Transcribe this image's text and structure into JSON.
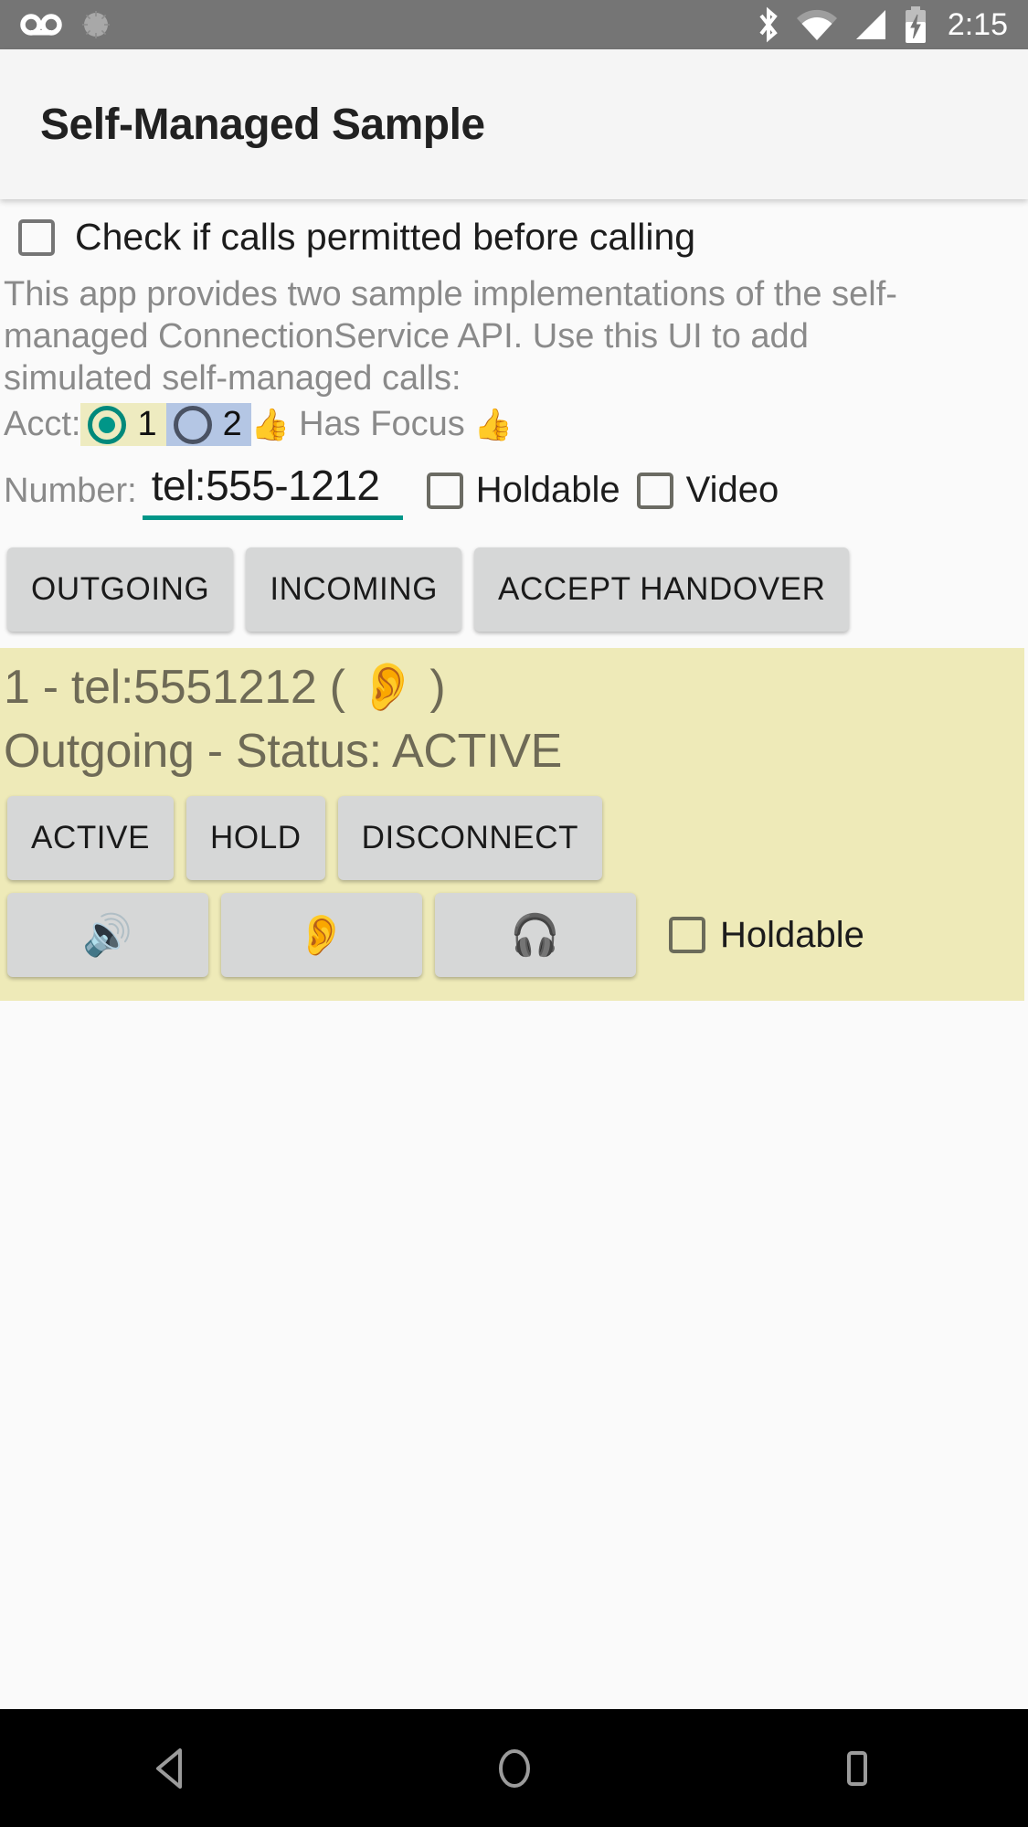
{
  "status_bar": {
    "background": "#757575",
    "time": "2:15",
    "left_icons": [
      {
        "name": "voicemail-icon",
        "glyph": "voicemail"
      },
      {
        "name": "sync-spinner-icon",
        "glyph": "spinner"
      }
    ],
    "right_icons": [
      {
        "name": "bluetooth-icon",
        "glyph": "bluetooth"
      },
      {
        "name": "wifi-icon",
        "glyph": "wifi"
      },
      {
        "name": "cell-signal-icon",
        "glyph": "signal"
      },
      {
        "name": "battery-charging-icon",
        "glyph": "battery-charging"
      }
    ]
  },
  "app_bar": {
    "title": "Self-Managed Sample",
    "background": "#f5f5f5"
  },
  "settings": {
    "permit_check": {
      "label": "Check if calls permitted before calling",
      "checked": false
    },
    "description": "This app provides two sample implementations of the self-managed ConnectionService API.  Use this UI to add simulated self-managed calls:"
  },
  "account": {
    "label": "Acct:",
    "options": [
      {
        "value": "1",
        "selected": true,
        "highlight": "#eeebc0",
        "accent": "#009688"
      },
      {
        "value": "2",
        "selected": false,
        "highlight": "#b4c6e4",
        "accent": "#4a5263"
      }
    ],
    "focus_text": "Has Focus",
    "focus_emoji_left": "👍",
    "focus_emoji_right": "👍"
  },
  "number_row": {
    "label": "Number:",
    "value": "tel:555-1212",
    "placeholder": "tel:",
    "underline_color": "#009688",
    "holdable": {
      "label": "Holdable",
      "checked": false
    },
    "video": {
      "label": "Video",
      "checked": false
    }
  },
  "action_buttons": [
    {
      "label": "OUTGOING",
      "name": "outgoing-button"
    },
    {
      "label": "INCOMING",
      "name": "incoming-button"
    },
    {
      "label": "ACCEPT HANDOVER",
      "name": "accept-handover-button"
    }
  ],
  "call_card": {
    "background": "#eeeab8",
    "title": "1 - tel:5551212 ( 👂 )",
    "status": "Outgoing - Status: ACTIVE",
    "state_buttons": [
      {
        "label": "ACTIVE",
        "name": "call-active-button"
      },
      {
        "label": "HOLD",
        "name": "call-hold-button"
      },
      {
        "label": "DISCONNECT",
        "name": "call-disconnect-button"
      }
    ],
    "audio_buttons": [
      {
        "label": "🔊",
        "name": "audio-route-speaker-button"
      },
      {
        "label": "👂",
        "name": "audio-route-earpiece-button"
      },
      {
        "label": "🎧",
        "name": "audio-route-headset-button"
      }
    ],
    "holdable": {
      "label": "Holdable",
      "checked": false
    }
  },
  "nav_bar": {
    "background": "#000000",
    "buttons": [
      {
        "name": "nav-back-button",
        "glyph": "triangle-left"
      },
      {
        "name": "nav-home-button",
        "glyph": "circle"
      },
      {
        "name": "nav-recents-button",
        "glyph": "square"
      }
    ]
  }
}
